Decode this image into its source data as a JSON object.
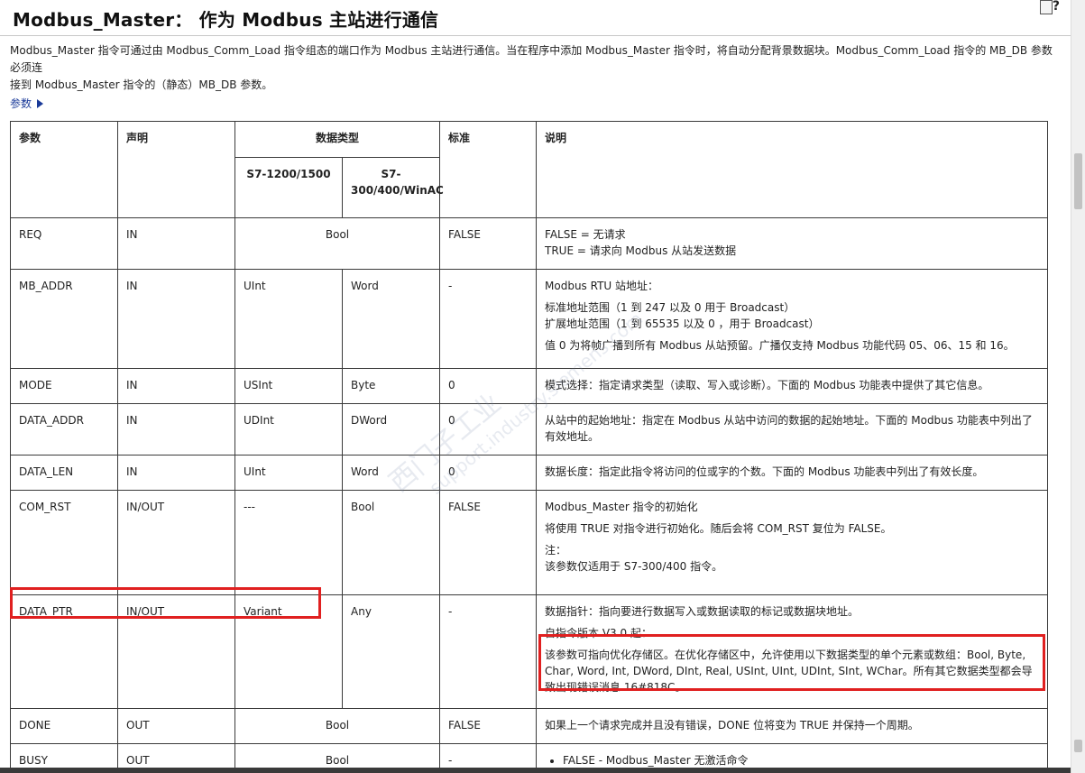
{
  "header": {
    "title": "Modbus_Master： 作为 Modbus 主站进行通信"
  },
  "intro": {
    "line1": "Modbus_Master 指令可通过由 Modbus_Comm_Load 指令组态的端口作为 Modbus 主站进行通信。当在程序中添加 Modbus_Master 指令时，将自动分配背景数据块。Modbus_Comm_Load 指令的 MB_DB 参数必须连",
    "line2": "接到 Modbus_Master 指令的（静态）MB_DB 参数。"
  },
  "params_link": {
    "label": "参数"
  },
  "table": {
    "headers": {
      "param": "参数",
      "decl": "声明",
      "datatype": "数据类型",
      "s71200": "S7-1200/1500",
      "s7300": "S7-300/400/WinAC",
      "standard": "标准",
      "desc": "说明"
    },
    "rows": {
      "req": {
        "param": "REQ",
        "decl": "IN",
        "type": "Bool",
        "standard": "FALSE",
        "desc": [
          "FALSE = 无请求",
          "TRUE = 请求向 Modbus 从站发送数据"
        ]
      },
      "mbaddr": {
        "param": "MB_ADDR",
        "decl": "IN",
        "type1": "UInt",
        "type2": "Word",
        "standard": "-",
        "desc": [
          "Modbus RTU 站地址：",
          "标准地址范围（1 到 247 以及 0 用于 Broadcast）",
          "扩展地址范围（1 到 65535 以及 0 ，用于 Broadcast）",
          "值 0 为将帧广播到所有 Modbus 从站预留。广播仅支持 Modbus 功能代码 05、06、15 和 16。"
        ]
      },
      "mode": {
        "param": "MODE",
        "decl": "IN",
        "type1": "USInt",
        "type2": "Byte",
        "standard": "0",
        "desc": [
          "模式选择：指定请求类型（读取、写入或诊断）。下面的 Modbus 功能表中提供了其它信息。"
        ]
      },
      "daddr": {
        "param": "DATA_ADDR",
        "decl": "IN",
        "type1": "UDInt",
        "type2": "DWord",
        "standard": "0",
        "desc": [
          "从站中的起始地址：指定在 Modbus 从站中访问的数据的起始地址。下面的 Modbus 功能表中列出了有效地址。"
        ]
      },
      "dlen": {
        "param": "DATA_LEN",
        "decl": "IN",
        "type1": "UInt",
        "type2": "Word",
        "standard": "0",
        "desc": [
          "数据长度：指定此指令将访问的位或字的个数。下面的 Modbus 功能表中列出了有效长度。"
        ]
      },
      "comrst": {
        "param": "COM_RST",
        "decl": "IN/OUT",
        "type1": "---",
        "type2": "Bool",
        "standard": "FALSE",
        "desc": [
          "Modbus_Master 指令的初始化",
          "将使用 TRUE 对指令进行初始化。随后会将 COM_RST 复位为 FALSE。",
          "注：",
          "该参数仅适用于 S7-300/400 指令。"
        ]
      },
      "dptr": {
        "param": "DATA_PTR",
        "decl": "IN/OUT",
        "type1": "Variant",
        "type2": "Any",
        "standard": "-",
        "desc": [
          "数据指针：指向要进行数据写入或数据读取的标记或数据块地址。",
          "自指令版本 V3.0 起：",
          "该参数可指向优化存储区。在优化存储区中，允许使用以下数据类型的单个元素或数组：Bool, Byte, Char, Word, Int, DWord, DInt, Real, USInt, UInt, UDInt, SInt, WChar。所有其它数据类型都会导致出现错误消息 16#818C。"
        ]
      },
      "done": {
        "param": "DONE",
        "decl": "OUT",
        "type": "Bool",
        "standard": "FALSE",
        "desc": [
          "如果上一个请求完成并且没有错误，DONE 位将变为 TRUE 并保持一个周期。"
        ]
      },
      "busy": {
        "param": "BUSY",
        "decl": "OUT",
        "type": "Bool",
        "standard": "-",
        "desc": [
          "FALSE - Modbus_Master 无激活命令"
        ]
      }
    }
  },
  "colors": {
    "highlight": "#e02020",
    "link": "#1a3a99",
    "border": "#3a3a3a"
  }
}
